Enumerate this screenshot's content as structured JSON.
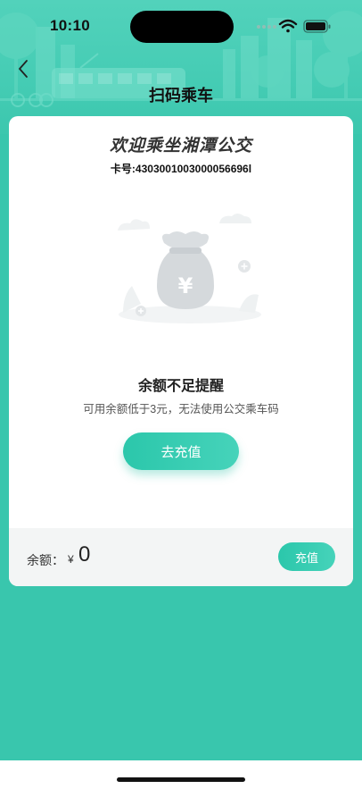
{
  "status_bar": {
    "time": "10:10"
  },
  "nav": {
    "title": "扫码乘车",
    "back_icon": "chevron-left-icon"
  },
  "card": {
    "welcome": "欢迎乘坐湘潭公交",
    "card_number": "卡号:4303001003000056696l",
    "illustration_icon": "money-bag-yuan-icon",
    "illustration_symbol": "¥",
    "warning_title": "余额不足提醒",
    "warning_desc": "可用余额低于3元，无法使用公交乘车码",
    "recharge_button": "去充值"
  },
  "balance": {
    "label": "余额：",
    "currency": "¥",
    "amount": "0",
    "recharge_button": "充值"
  },
  "colors": {
    "accent": "#39c6ad",
    "button_gradient_start": "#2bc7ab",
    "button_gradient_end": "#46d3ba"
  }
}
